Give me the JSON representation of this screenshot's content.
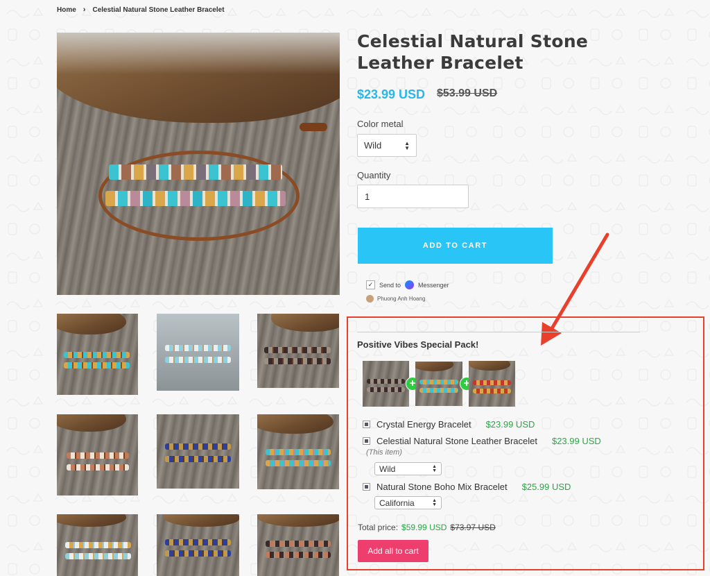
{
  "breadcrumb": {
    "home": "Home",
    "separator": "›",
    "current": "Celestial Natural Stone Leather Bracelet"
  },
  "product": {
    "title": "Celestial Natural Stone Leather Bracelet",
    "price": "$23.99 USD",
    "compare_price": "$53.99 USD",
    "color_label": "Color metal",
    "color_value": "Wild",
    "quantity_label": "Quantity",
    "quantity_value": "1",
    "add_to_cart": "ADD TO CART"
  },
  "messenger": {
    "send_to": "Send to",
    "messenger": "Messenger",
    "user": "Phuong Anh Hoang",
    "icon": "messenger-icon"
  },
  "bundle": {
    "title": "Positive Vibes Special Pack!",
    "items": [
      {
        "name": "Crystal Energy Bracelet",
        "price": "$23.99 USD"
      },
      {
        "name": "Celestial Natural Stone Leather Bracelet",
        "price": "$23.99 USD",
        "note": "(This item)",
        "option": "Wild"
      },
      {
        "name": "Natural Stone Boho Mix Bracelet",
        "price": "$25.99 USD",
        "option": "California"
      }
    ],
    "total_label": "Total price:",
    "total_price": "$59.99 USD",
    "total_compare": "$73.97 USD",
    "add_all": "Add all to cart"
  },
  "colors": {
    "accent_blue": "#29c5f6",
    "price_blue": "#29b6e8",
    "green": "#27a844",
    "pink": "#ee3e6d",
    "annotation_red": "#e8402b"
  }
}
